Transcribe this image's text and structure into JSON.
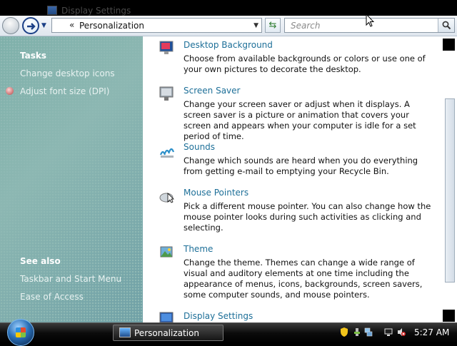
{
  "window": {
    "title": "Display Settings"
  },
  "navbar": {
    "address_prefix": "«",
    "address_text": "Personalization",
    "search_placeholder": "Search"
  },
  "sidebar": {
    "tasks_heading": "Tasks",
    "tasks": [
      {
        "label": "Change desktop icons"
      },
      {
        "label": "Adjust font size (DPI)"
      }
    ],
    "see_also_heading": "See also",
    "see_also": [
      {
        "label": "Taskbar and Start Menu"
      },
      {
        "label": "Ease of Access"
      }
    ]
  },
  "items": [
    {
      "title": "Desktop Background",
      "description": "Choose from available backgrounds or colors or use one of your own pictures to decorate the desktop.",
      "icon": "desktop-background-icon"
    },
    {
      "title": "Screen Saver",
      "description": "Change your screen saver or adjust when it displays. A screen saver is a picture or animation that covers your screen and appears when your computer is idle for a set period of time.",
      "icon": "screen-saver-icon"
    },
    {
      "title": "Sounds",
      "description": "Change which sounds are heard when you do everything from getting e-mail to emptying your Recycle Bin.",
      "icon": "sounds-icon"
    },
    {
      "title": "Mouse Pointers",
      "description": "Pick a different mouse pointer. You can also change how the mouse pointer looks during such activities as clicking and selecting.",
      "icon": "mouse-pointers-icon"
    },
    {
      "title": "Theme",
      "description": "Change the theme. Themes can change a wide range of visual and auditory elements at one time including the appearance of menus, icons, backgrounds, screen savers, some computer sounds, and mouse pointers.",
      "icon": "theme-icon"
    },
    {
      "title": "Display Settings",
      "description": "",
      "icon": "display-settings-icon"
    }
  ],
  "taskbar": {
    "task_label": "Personalization",
    "clock": "5:27 AM"
  },
  "colors": {
    "link": "#1d6f98",
    "sidebar": "#7da9a4"
  }
}
